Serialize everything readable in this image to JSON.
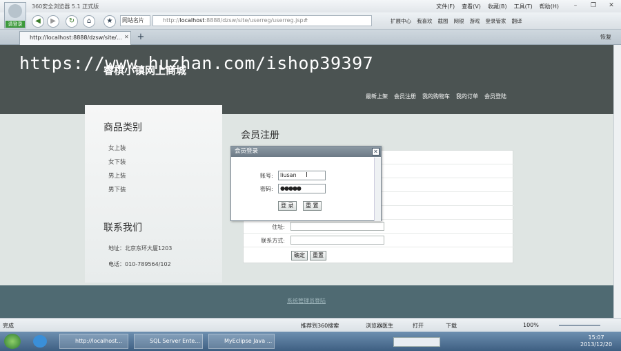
{
  "browser": {
    "app_title": "360安全浏览器 5.1 正式版",
    "login_chip": "请登录",
    "menu": [
      "文件(F)",
      "查看(V)",
      "收藏(B)",
      "工具(T)",
      "帮助(H)"
    ],
    "nav_group_label": "网站名片",
    "address_prefix": "http://",
    "address_host": "localhost",
    "address_rest": ":8888/dzsw/site/userreg/userreg.jsp#",
    "toolbar_links": [
      "扩展中心",
      "我喜欢",
      "截图",
      "网银",
      "游戏",
      "登录管家",
      "翻译"
    ],
    "tab_title": "http://localhost:8888/dzsw/site/...",
    "tab_right_label": "恢复"
  },
  "watermark": "https://www.huzhan.com/ishop39397",
  "site": {
    "title": "睿棋小镇网上商城",
    "nav": [
      "最新上架",
      "会员注册",
      "我的购物车",
      "我的订单",
      "会员登陆"
    ],
    "category_title": "商品类别",
    "categories": [
      "女上装",
      "女下装",
      "男上装",
      "男下装"
    ],
    "contact_title": "联系我们",
    "address_line": "地址：北京东环大厦1203",
    "phone_line": "电话：010-789564/102",
    "reg_title": "会员注册",
    "reg_fields": [
      {
        "label": "住址:"
      },
      {
        "label": "联系方式:"
      }
    ],
    "reg_confirm": "确定",
    "reg_reset": "重置",
    "footer_link": "系统管理员登陆"
  },
  "dialog": {
    "title": "会员登录",
    "account_label": "账号:",
    "account_value": "liusan",
    "password_label": "密码:",
    "password_value": "●●●●●",
    "login_button": "登 录",
    "reset_button": "重 置"
  },
  "status": {
    "left_text": "完成",
    "items": [
      "推荐到360搜索",
      "浏览器医生",
      "打开",
      "下载"
    ],
    "zoom": "100%"
  },
  "taskbar": {
    "items": [
      "http://localhost...",
      "SQL Server Ente...",
      "MyEclipse Java ..."
    ],
    "time": "15:07",
    "date": "2013/12/20"
  }
}
